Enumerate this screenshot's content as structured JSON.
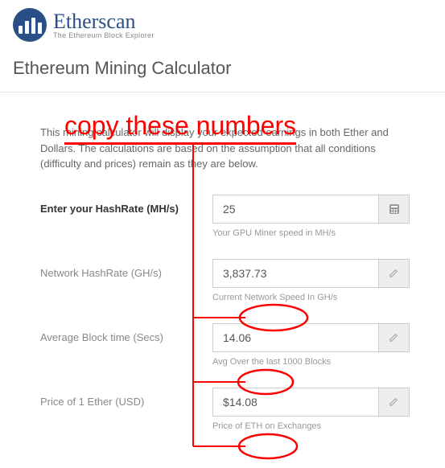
{
  "brand": {
    "name": "Etherscan",
    "tagline": "The Ethereum Block Explorer"
  },
  "page": {
    "title": "Ethereum Mining Calculator",
    "intro": "This mining calculator will display your expected earnings in both Ether and Dollars. The calculations are based on the assumption that all conditions (difficulty and prices) remain as they are below."
  },
  "fields": {
    "hashrate": {
      "label": "Enter your HashRate (MH/s)",
      "value": "25",
      "hint": "Your GPU Miner speed in MH/s"
    },
    "network": {
      "label": "Network HashRate (GH/s)",
      "value": "3,837.73",
      "hint": "Current Network Speed In GH/s"
    },
    "blocktime": {
      "label": "Average Block time (Secs)",
      "value": "14.06",
      "hint": "Avg Over the last 1000 Blocks"
    },
    "price": {
      "label": "Price of 1 Ether (USD)",
      "value": "$14.08",
      "hint": "Price of ETH on Exchanges"
    }
  },
  "annotation": {
    "text": "copy these numbers"
  }
}
